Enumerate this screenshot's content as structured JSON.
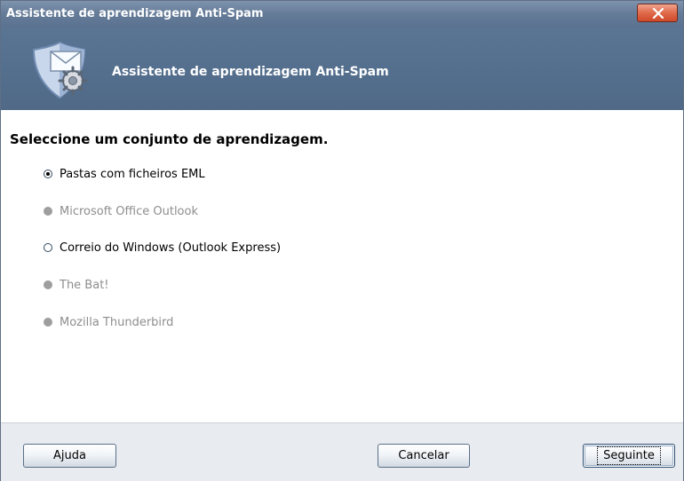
{
  "window": {
    "title": "Assistente de aprendizagem Anti-Spam",
    "close_label": "X"
  },
  "header": {
    "title": "Assistente de aprendizagem Anti-Spam",
    "icon": "shield-mail-gear-icon"
  },
  "content": {
    "heading": "Seleccione um conjunto de aprendizagem.",
    "options": [
      {
        "label": "Pastas com ficheiros EML",
        "selected": true,
        "enabled": true
      },
      {
        "label": "Microsoft Office Outlook",
        "selected": false,
        "enabled": false
      },
      {
        "label": "Correio do Windows (Outlook Express)",
        "selected": false,
        "enabled": true
      },
      {
        "label": "The Bat!",
        "selected": false,
        "enabled": false
      },
      {
        "label": "Mozilla Thunderbird",
        "selected": false,
        "enabled": false
      }
    ]
  },
  "footer": {
    "help_label": "Ajuda",
    "cancel_label": "Cancelar",
    "next_label": "Seguinte"
  },
  "colors": {
    "titlebar": "#667d99",
    "header": "#4f6987",
    "footer": "#e8ebef",
    "disabled_text": "#8e8e8e"
  }
}
